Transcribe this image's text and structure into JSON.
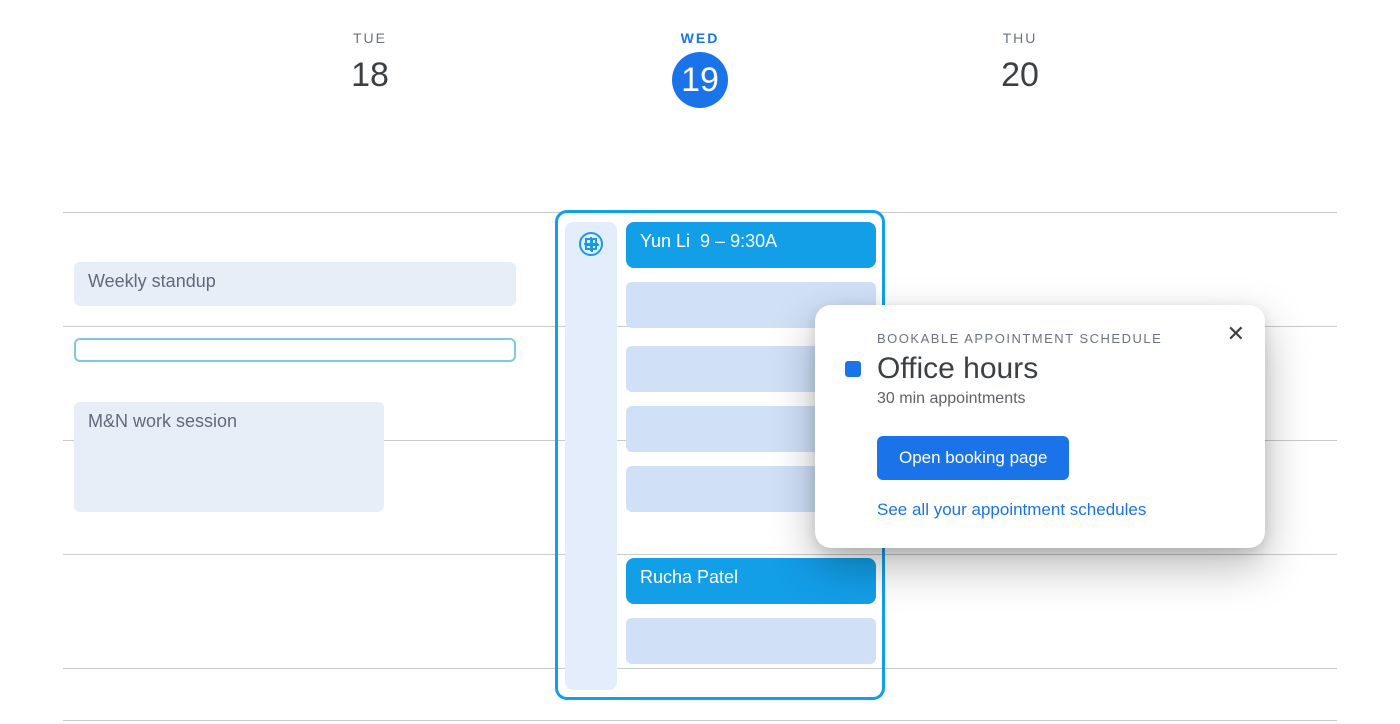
{
  "days": [
    {
      "dow": "TUE",
      "num": "18",
      "active": false
    },
    {
      "dow": "WED",
      "num": "19",
      "active": true
    },
    {
      "dow": "THU",
      "num": "20",
      "active": false
    }
  ],
  "tuesday_events": {
    "standup": "Weekly standup",
    "work": "M&N work session"
  },
  "wed_slots": {
    "yun": {
      "name": "Yun Li",
      "time": "9 – 9:30A"
    },
    "rucha": {
      "name": "Rucha Patel"
    }
  },
  "popover": {
    "overline": "BOOKABLE APPOINTMENT SCHEDULE",
    "title": "Office hours",
    "subtitle": "30 min appointments",
    "button": "Open booking page",
    "link": "See all your appointment schedules"
  }
}
